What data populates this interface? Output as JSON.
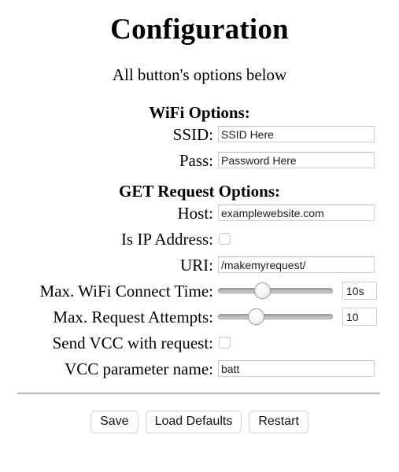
{
  "page": {
    "title": "Configuration",
    "subtitle": "All button's options below"
  },
  "sections": {
    "wifi": {
      "heading": "WiFi Options:",
      "fields": {
        "ssid": {
          "label": "SSID:",
          "value": "SSID Here"
        },
        "pass": {
          "label": "Pass:",
          "value": "Password Here"
        }
      }
    },
    "get_request": {
      "heading": "GET Request Options:",
      "fields": {
        "host": {
          "label": "Host:",
          "value": "examplewebsite.com"
        },
        "is_ip": {
          "label": "Is IP Address:",
          "checked": false
        },
        "uri": {
          "label": "URI:",
          "value": "/makemyrequest/"
        },
        "max_wifi_time": {
          "label": "Max. WiFi Connect Time:",
          "value": "10s",
          "slider_percent": 37
        },
        "max_attempts": {
          "label": "Max. Request Attempts:",
          "value": "10",
          "slider_percent": 30
        },
        "send_vcc": {
          "label": "Send VCC with request:",
          "checked": false
        },
        "vcc_param": {
          "label": "VCC parameter name:",
          "value": "batt"
        }
      }
    }
  },
  "buttons": {
    "save": "Save",
    "load_defaults": "Load Defaults",
    "restart": "Restart"
  }
}
